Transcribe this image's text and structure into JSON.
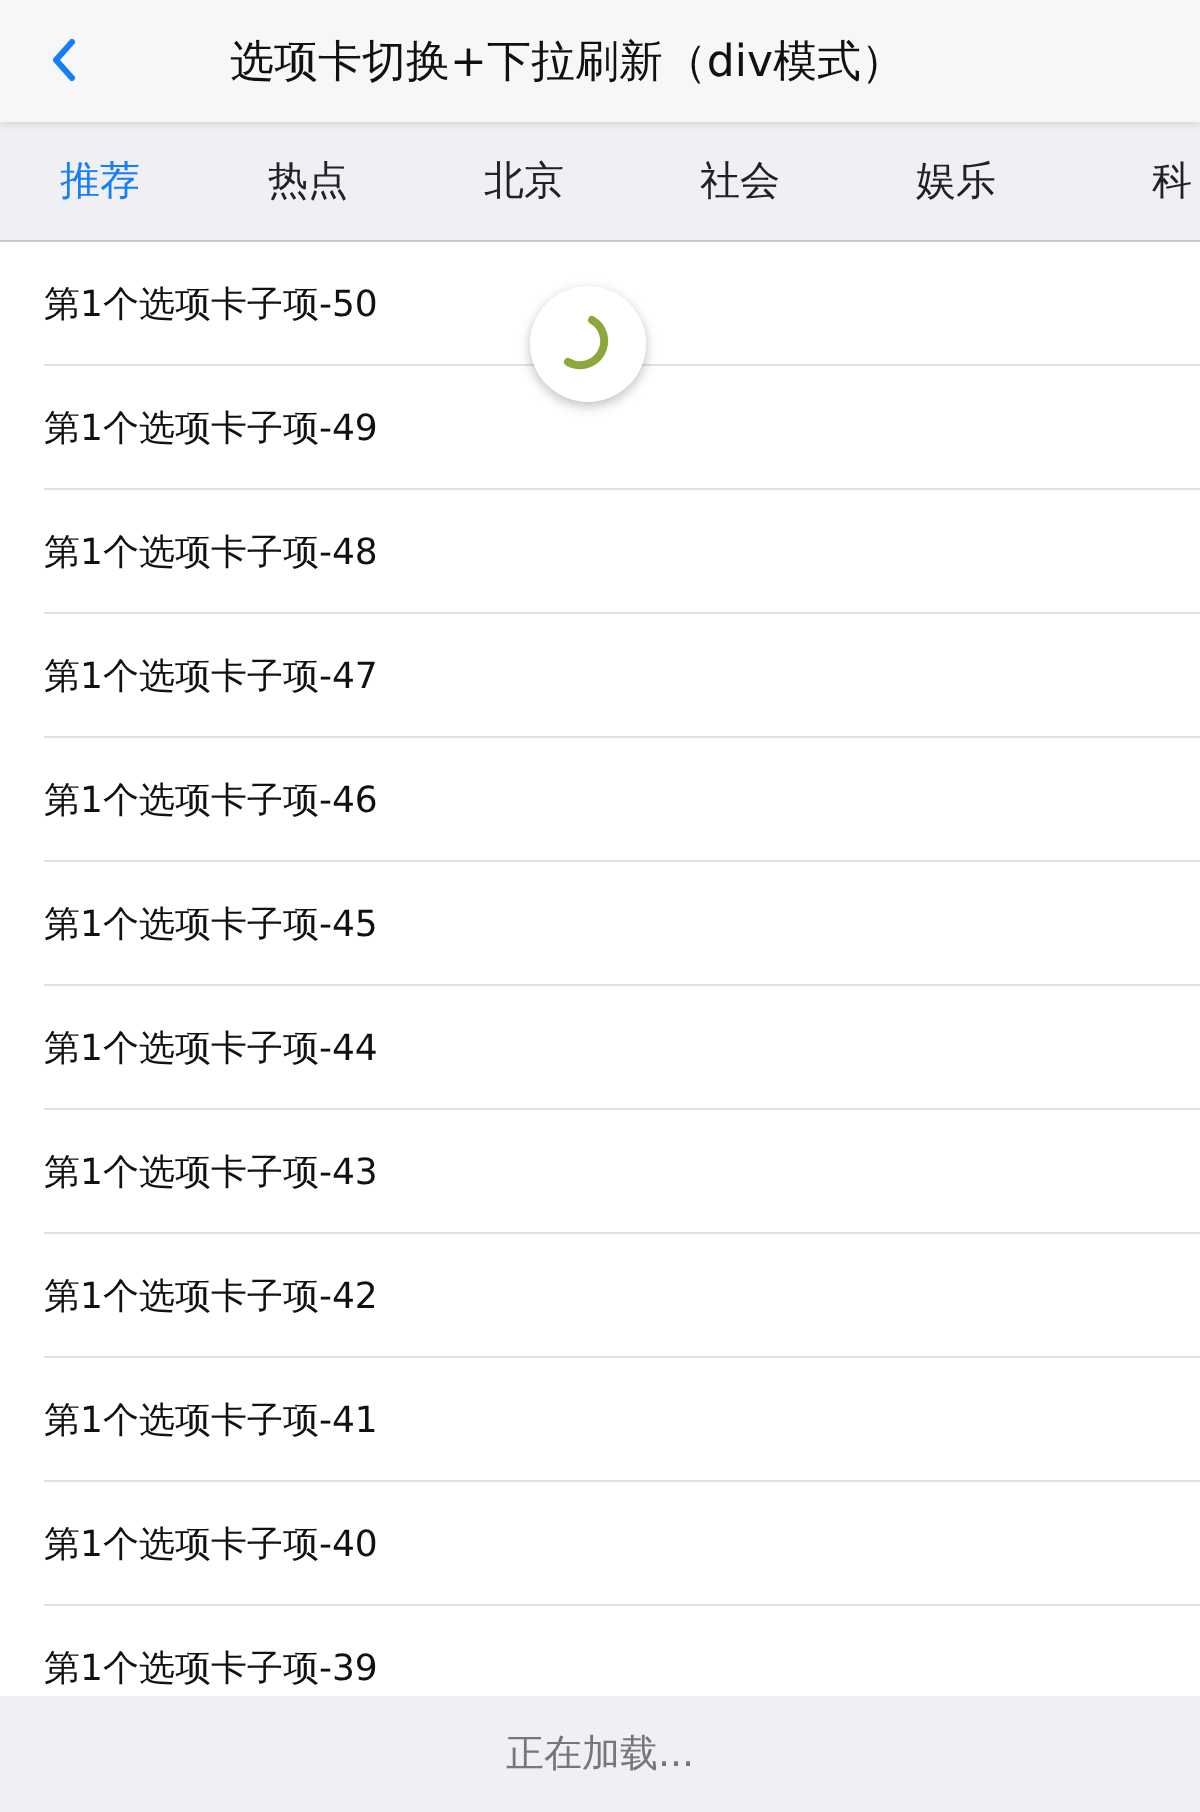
{
  "header": {
    "title": "选项卡切换+下拉刷新（div模式）"
  },
  "tabs": [
    {
      "label": "推荐",
      "selected": true
    },
    {
      "label": "热点",
      "selected": false
    },
    {
      "label": "北京",
      "selected": false
    },
    {
      "label": "社会",
      "selected": false
    },
    {
      "label": "娱乐",
      "selected": false
    },
    {
      "label": "科",
      "selected": false
    }
  ],
  "refreshing": true,
  "items": [
    "第1个选项卡子项-50",
    "第1个选项卡子项-49",
    "第1个选项卡子项-48",
    "第1个选项卡子项-47",
    "第1个选项卡子项-46",
    "第1个选项卡子项-45",
    "第1个选项卡子项-44",
    "第1个选项卡子项-43",
    "第1个选项卡子项-42",
    "第1个选项卡子项-41",
    "第1个选项卡子项-40",
    "第1个选项卡子项-39"
  ],
  "footer": {
    "status": "正在加载..."
  }
}
